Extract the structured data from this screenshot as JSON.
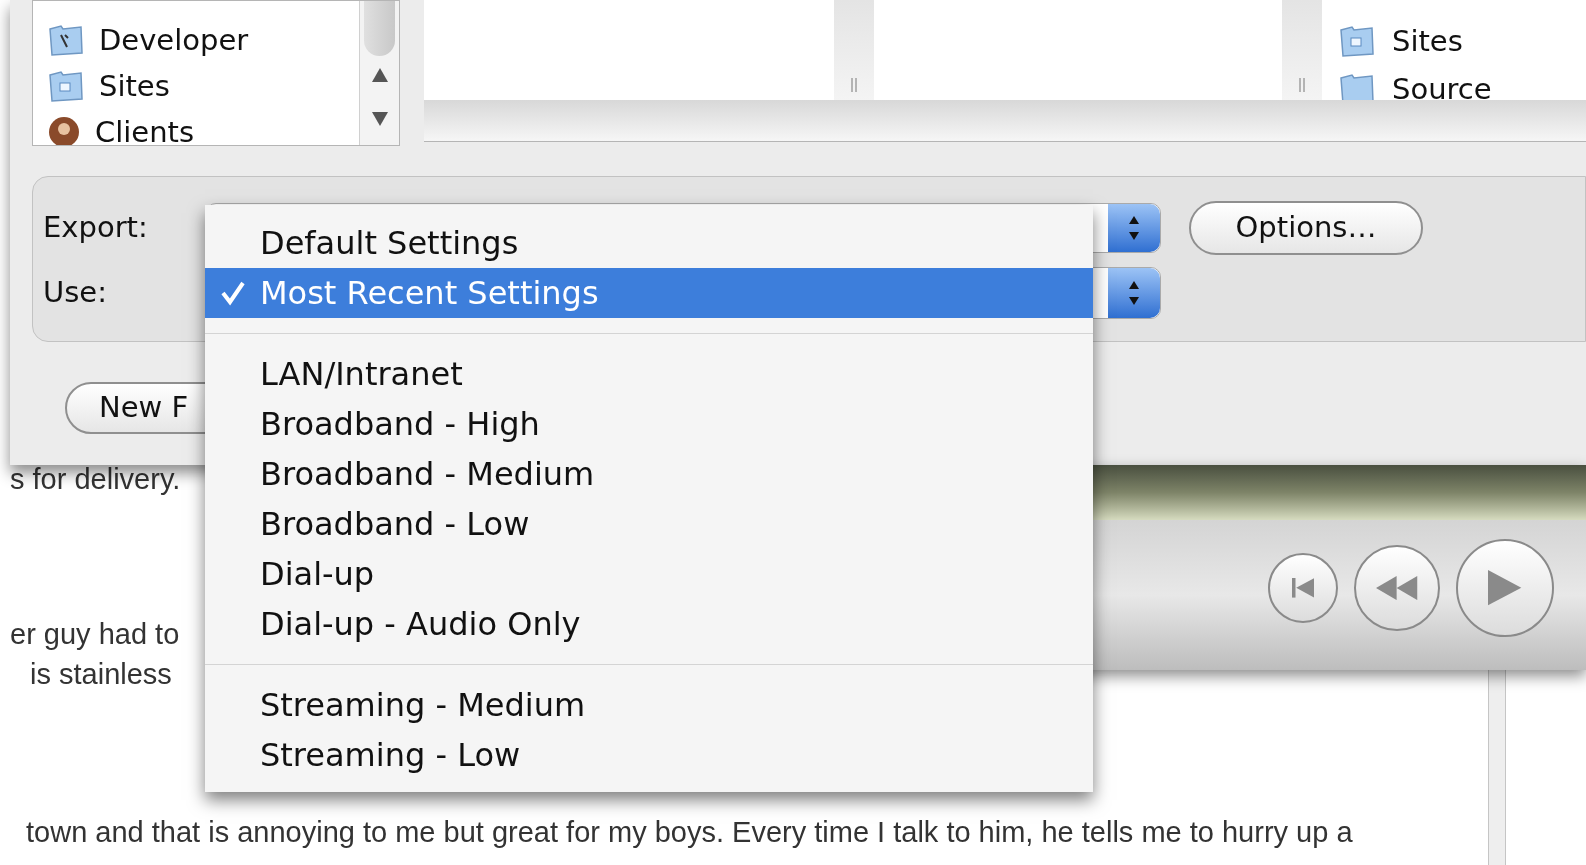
{
  "file_browser": {
    "left_list": [
      {
        "name": "Developer",
        "kind": "tool-folder"
      },
      {
        "name": "Sites",
        "kind": "site-folder"
      },
      {
        "name": "Clients",
        "kind": "person"
      }
    ],
    "right_list": [
      {
        "name": "Sites",
        "kind": "site-folder"
      },
      {
        "name": "Source",
        "kind": "folder"
      }
    ]
  },
  "export_panel": {
    "export_label": "Export:",
    "use_label": "Use:",
    "options_button": "Options…"
  },
  "new_folder_button": "New F",
  "document": {
    "lines": [
      "s for delivery.",
      "er guy had to",
      "is stainless",
      "town and that is annoying to me but great for my boys. Every time I talk to him, he tells me to hurry up a"
    ]
  },
  "player": {
    "buttons": [
      {
        "kind": "skip-back"
      },
      {
        "kind": "rewind"
      },
      {
        "kind": "play"
      }
    ]
  },
  "menu": {
    "items": [
      {
        "kind": "item",
        "label": "Default Settings",
        "selected": false
      },
      {
        "kind": "item",
        "label": "Most Recent Settings",
        "selected": true
      },
      {
        "kind": "separator"
      },
      {
        "kind": "item",
        "label": "LAN/Intranet",
        "selected": false
      },
      {
        "kind": "item",
        "label": "Broadband - High",
        "selected": false
      },
      {
        "kind": "item",
        "label": "Broadband - Medium",
        "selected": false
      },
      {
        "kind": "item",
        "label": "Broadband - Low",
        "selected": false
      },
      {
        "kind": "item",
        "label": "Dial-up",
        "selected": false
      },
      {
        "kind": "item",
        "label": "Dial-up - Audio Only",
        "selected": false
      },
      {
        "kind": "separator"
      },
      {
        "kind": "item",
        "label": "Streaming - Medium",
        "selected": false
      },
      {
        "kind": "item",
        "label": "Streaming - Low",
        "selected": false
      }
    ]
  }
}
